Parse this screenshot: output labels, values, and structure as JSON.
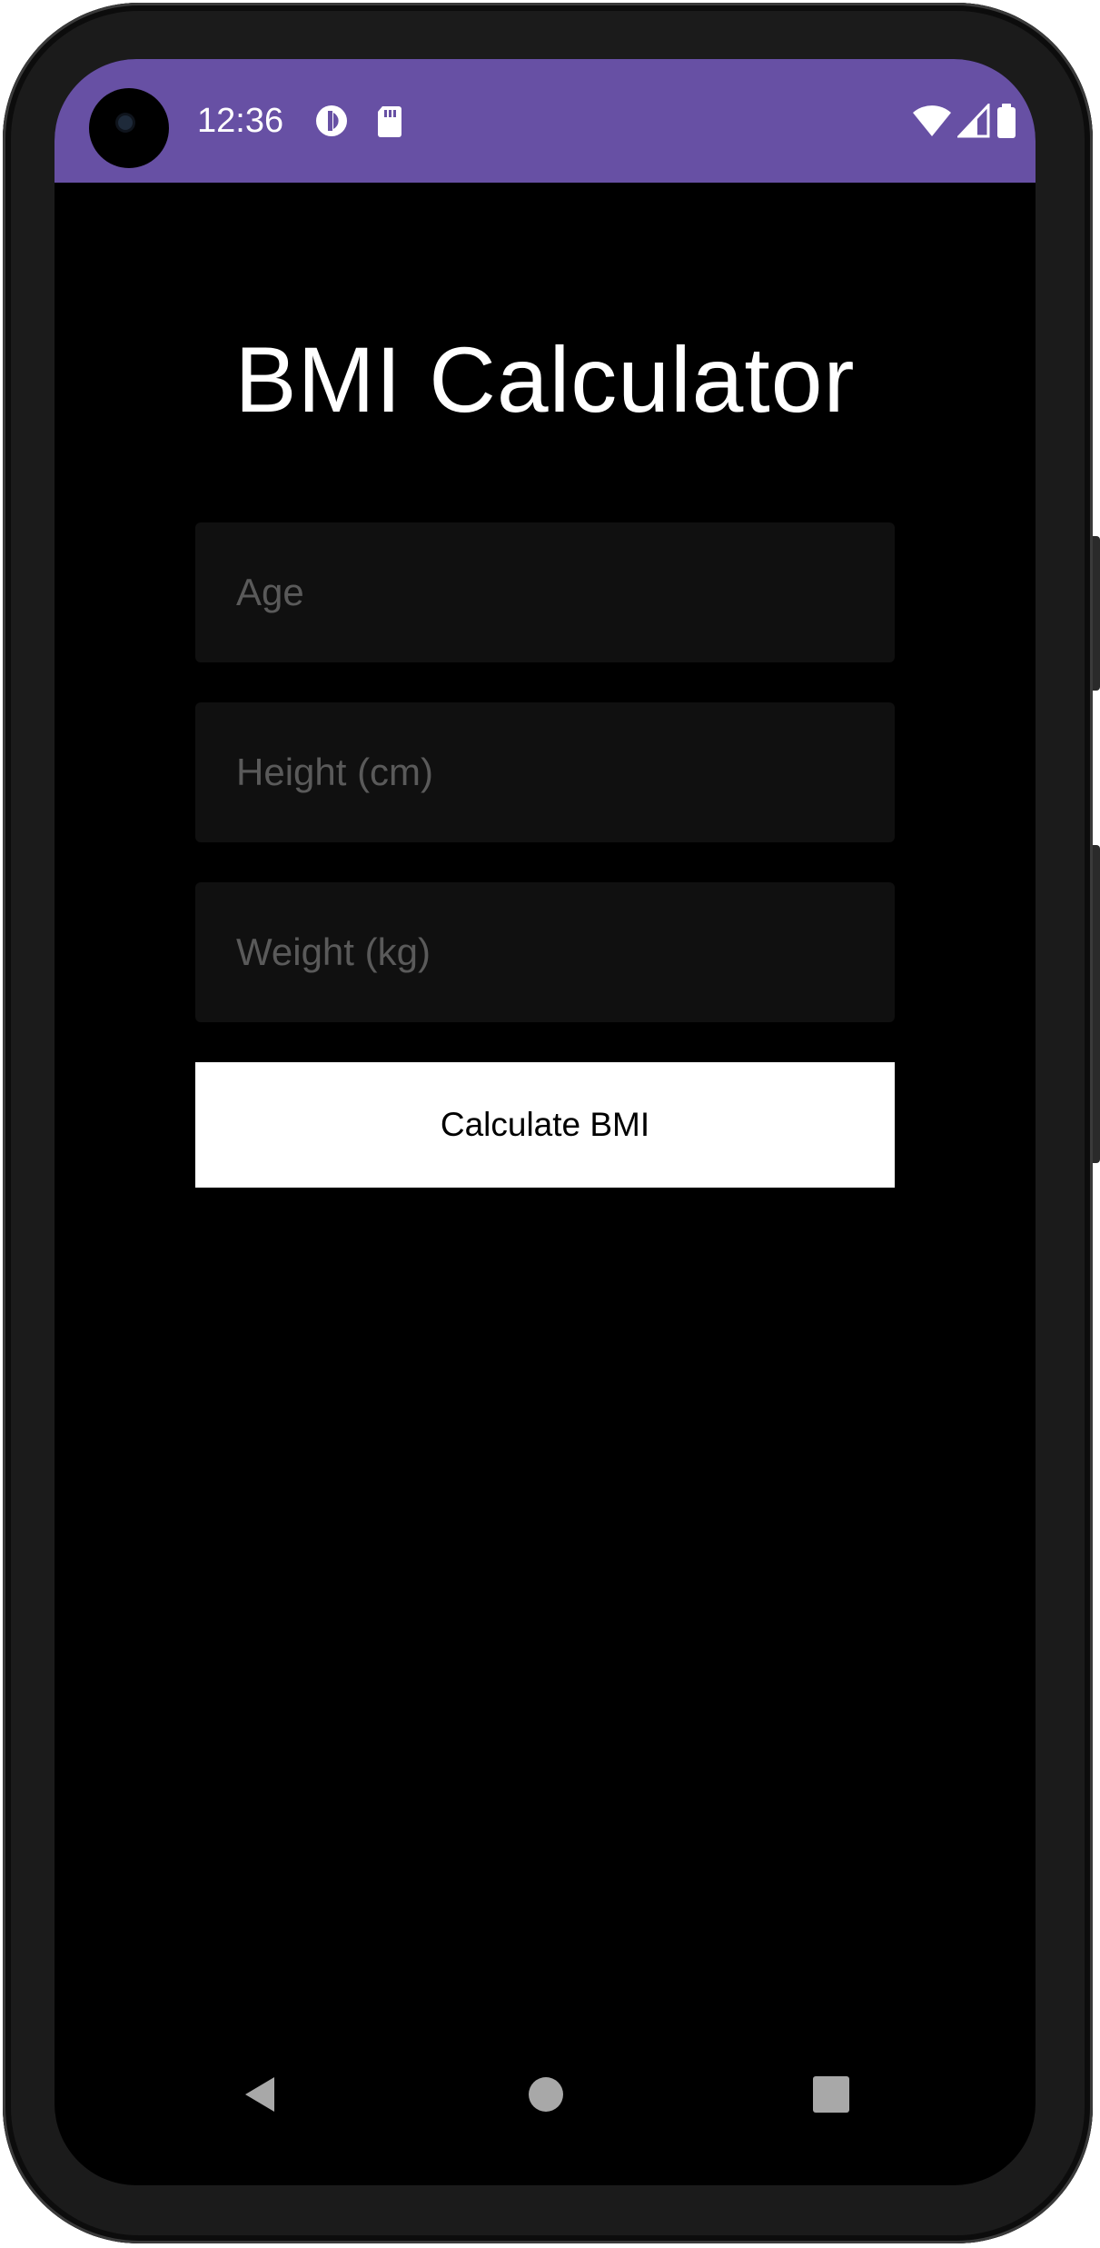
{
  "status_bar": {
    "time": "12:36",
    "background_color": "#6750a4",
    "icons_left": [
      "data-saver-icon",
      "sd-card-icon"
    ],
    "icons_right": [
      "wifi-icon",
      "cell-signal-icon",
      "battery-icon"
    ]
  },
  "app": {
    "title": "BMI Calculator",
    "fields": {
      "age": {
        "placeholder": "Age",
        "value": ""
      },
      "height": {
        "placeholder": "Height (cm)",
        "value": ""
      },
      "weight": {
        "placeholder": "Weight (kg)",
        "value": ""
      }
    },
    "calculate_button_label": "Calculate BMI"
  },
  "nav_bar": {
    "icons": [
      "back-icon",
      "home-icon",
      "recents-icon"
    ]
  }
}
